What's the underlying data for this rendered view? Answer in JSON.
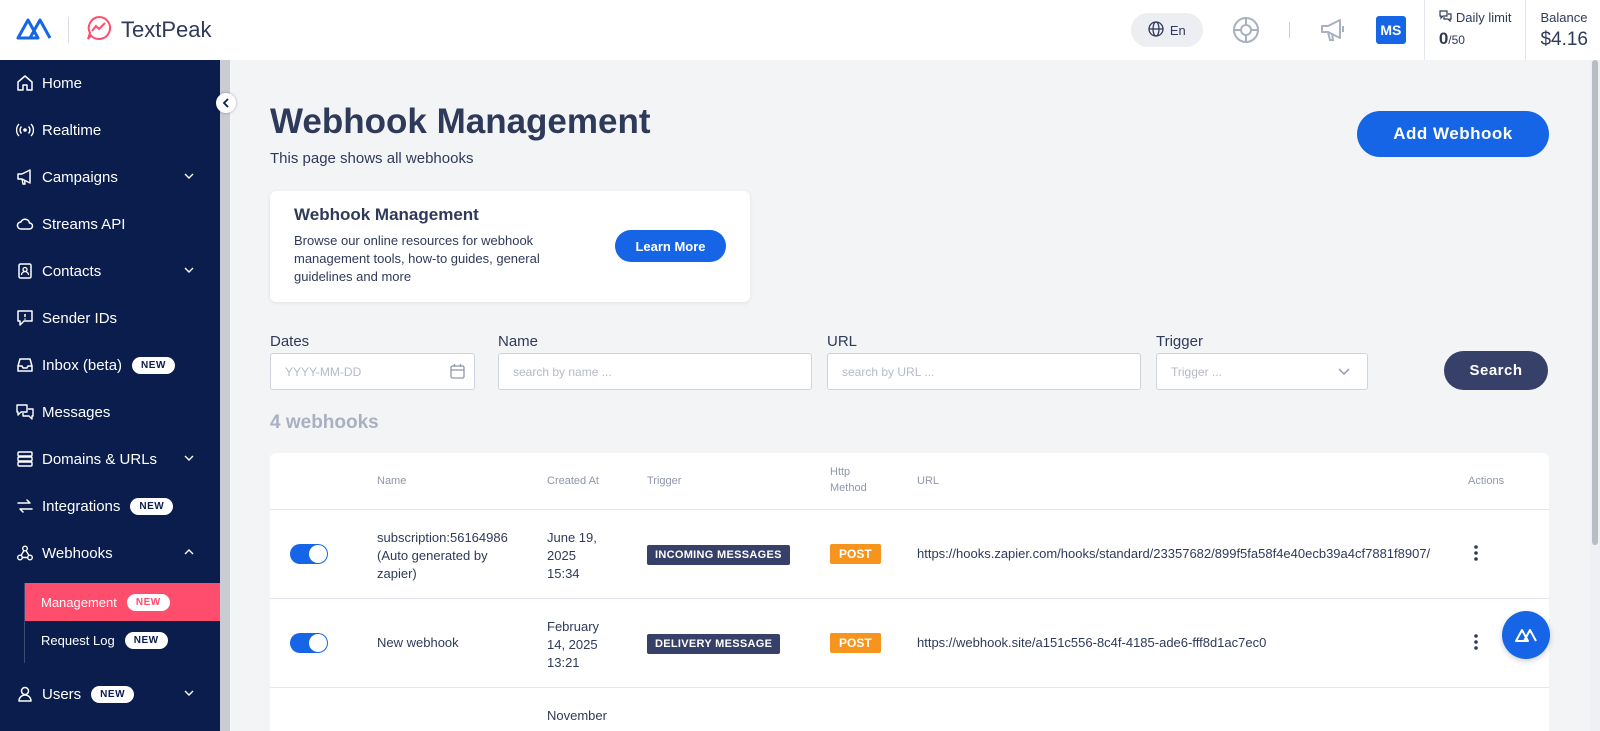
{
  "brand": {
    "name": "TextPeak"
  },
  "topbar": {
    "language": "En",
    "avatar_initials": "MS",
    "daily_limit": {
      "label": "Daily limit",
      "used": "0",
      "total": "/50"
    },
    "balance": {
      "label": "Balance",
      "value": "$4.16"
    }
  },
  "sidebar": {
    "items": [
      {
        "label": "Home"
      },
      {
        "label": "Realtime"
      },
      {
        "label": "Campaigns"
      },
      {
        "label": "Streams API"
      },
      {
        "label": "Contacts"
      },
      {
        "label": "Sender IDs"
      },
      {
        "label": "Inbox (beta)",
        "badge": "NEW"
      },
      {
        "label": "Messages"
      },
      {
        "label": "Domains & URLs"
      },
      {
        "label": "Integrations",
        "badge": "NEW"
      },
      {
        "label": "Webhooks"
      },
      {
        "label": "Users",
        "badge": "NEW"
      }
    ],
    "subitems": [
      {
        "label": "Management",
        "badge": "NEW"
      },
      {
        "label": "Request Log",
        "badge": "NEW"
      }
    ]
  },
  "page": {
    "title": "Webhook Management",
    "subtitle": "This page shows all webhooks",
    "add_button": "Add Webhook"
  },
  "info_card": {
    "title": "Webhook Management",
    "text": "Browse our online resources for webhook management tools, how-to guides, general guidelines and more",
    "button": "Learn More"
  },
  "filters": {
    "dates": {
      "label": "Dates",
      "placeholder": "YYYY-MM-DD"
    },
    "name": {
      "label": "Name",
      "placeholder": "search by name ..."
    },
    "url": {
      "label": "URL",
      "placeholder": "search by URL ..."
    },
    "trigger": {
      "label": "Trigger",
      "placeholder": "Trigger ..."
    },
    "search_button": "Search"
  },
  "count_label": "4 webhooks",
  "table": {
    "headers": {
      "name": "Name",
      "created_at": "Created At",
      "trigger": "Trigger",
      "http_method_1": "Http",
      "http_method_2": "Method",
      "url": "URL",
      "actions": "Actions"
    },
    "rows": [
      {
        "enabled": true,
        "name_1": "subscription:56164986",
        "name_2": "(Auto generated by",
        "name_3": "zapier)",
        "date_1": "June 19,",
        "date_2": "2025",
        "date_3": "15:34",
        "trigger": "INCOMING MESSAGES",
        "method": "POST",
        "url": "https://hooks.zapier.com/hooks/standard/23357682/899f5fa58f4e40ecb39a4cf7881f8907/"
      },
      {
        "enabled": true,
        "name_1": "New webhook",
        "date_1": "February",
        "date_2": "14, 2025",
        "date_3": "13:21",
        "trigger": "DELIVERY MESSAGE",
        "method": "POST",
        "url": "https://webhook.site/a151c556-8c4f-4185-ade6-fff8d1ac7ec0"
      },
      {
        "date_1": "November"
      }
    ]
  },
  "colors": {
    "primary": "#1565e6",
    "sidebar": "#0a1d4d",
    "active": "#ff4d6d",
    "badge_method": "#f7941d",
    "badge_trigger": "#364068"
  }
}
